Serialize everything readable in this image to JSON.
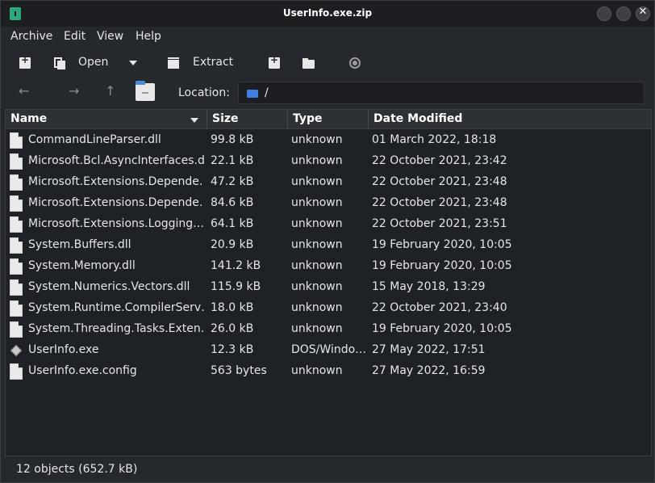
{
  "window": {
    "title": "UserInfo.exe.zip",
    "buttons": {
      "minimize": "–",
      "maximize": "",
      "close": "✕"
    }
  },
  "menu": [
    "Archive",
    "Edit",
    "View",
    "Help"
  ],
  "toolbar": {
    "open_label": "Open",
    "extract_label": "Extract"
  },
  "location": {
    "label": "Location:",
    "path": "/"
  },
  "columns": {
    "name": "Name",
    "size": "Size",
    "type": "Type",
    "date": "Date Modified"
  },
  "files": [
    {
      "name": "CommandLineParser.dll",
      "size": "99.8 kB",
      "type": "unknown",
      "date": "01 March 2022, 18:18",
      "icon": "file-icon"
    },
    {
      "name": "Microsoft.Bcl.AsyncInterfaces.dll",
      "size": "22.1 kB",
      "type": "unknown",
      "date": "22 October 2021, 23:42",
      "icon": "file-icon"
    },
    {
      "name": "Microsoft.Extensions.Depende…",
      "size": "47.2 kB",
      "type": "unknown",
      "date": "22 October 2021, 23:48",
      "icon": "file-icon"
    },
    {
      "name": "Microsoft.Extensions.Depende…",
      "size": "84.6 kB",
      "type": "unknown",
      "date": "22 October 2021, 23:48",
      "icon": "file-icon"
    },
    {
      "name": "Microsoft.Extensions.Logging.…",
      "size": "64.1 kB",
      "type": "unknown",
      "date": "22 October 2021, 23:51",
      "icon": "file-icon"
    },
    {
      "name": "System.Buffers.dll",
      "size": "20.9 kB",
      "type": "unknown",
      "date": "19 February 2020, 10:05",
      "icon": "file-icon"
    },
    {
      "name": "System.Memory.dll",
      "size": "141.2 kB",
      "type": "unknown",
      "date": "19 February 2020, 10:05",
      "icon": "file-icon"
    },
    {
      "name": "System.Numerics.Vectors.dll",
      "size": "115.9 kB",
      "type": "unknown",
      "date": "15 May 2018, 13:29",
      "icon": "file-icon"
    },
    {
      "name": "System.Runtime.CompilerServ…",
      "size": "18.0 kB",
      "type": "unknown",
      "date": "22 October 2021, 23:40",
      "icon": "file-icon"
    },
    {
      "name": "System.Threading.Tasks.Exten…",
      "size": "26.0 kB",
      "type": "unknown",
      "date": "19 February 2020, 10:05",
      "icon": "file-icon"
    },
    {
      "name": "UserInfo.exe",
      "size": "12.3 kB",
      "type": "DOS/Windo…",
      "date": "27 May 2022, 17:51",
      "icon": "executable-icon"
    },
    {
      "name": "UserInfo.exe.config",
      "size": "563 bytes",
      "type": "unknown",
      "date": "27 May 2022, 16:59",
      "icon": "file-icon"
    }
  ],
  "status": "12 objects (652.7 kB)"
}
